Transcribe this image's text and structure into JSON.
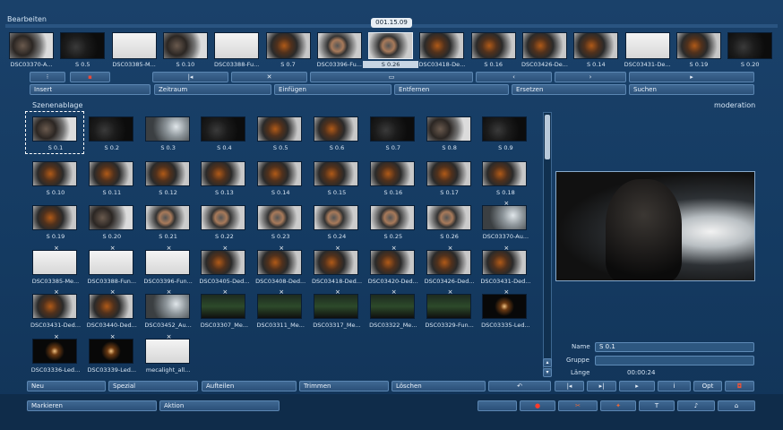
{
  "header": {
    "section_edit": "Bearbeiten",
    "timecode": "001.15.09"
  },
  "timeline": {
    "captions": [
      "DSC03370-A...",
      "S 0.5",
      "DSC03385-M...",
      "S 0.10",
      "DSC03388-Fu...",
      "S 0.7",
      "DSC03396-Fu...",
      "S 0.26",
      "DSC03418-De...",
      "S 0.16",
      "DSC03426-De...",
      "S 0.14",
      "DSC03431-De...",
      "S 0.19",
      "S 0.20"
    ]
  },
  "toolbar1": {
    "insert": "Insert",
    "timespan": "Zeitraum",
    "paste": "Einfügen",
    "remove": "Entfernen",
    "replace": "Ersetzen",
    "search": "Suchen"
  },
  "bin": {
    "title": "Szenenablage",
    "category": "moderation"
  },
  "scenes": [
    [
      "S 0.1",
      "S 0.2",
      "S 0.3",
      "S 0.4",
      "S 0.5",
      "S 0.6",
      "S 0.7",
      "S 0.8",
      "S 0.9"
    ],
    [
      "S 0.10",
      "S 0.11",
      "S 0.12",
      "S 0.13",
      "S 0.14",
      "S 0.15",
      "S 0.16",
      "S 0.17",
      "S 0.18"
    ],
    [
      "S 0.19",
      "S 0.20",
      "S 0.21",
      "S 0.22",
      "S 0.23",
      "S 0.24",
      "S 0.25",
      "S 0.26",
      "DSC03370-Au..."
    ],
    [
      "DSC03385-Me...",
      "DSC03388-Fun...",
      "DSC03396-Fun...",
      "DSC03405-Ded...",
      "DSC03408-Ded...",
      "DSC03418-Ded...",
      "DSC03420-Ded...",
      "DSC03426-Ded...",
      "DSC03431-Ded..."
    ],
    [
      "DSC03431-Ded...",
      "DSC03440-Ded...",
      "DSC03452_Au...",
      "DSC03307_Me...",
      "DSC03311_Me...",
      "DSC03317_Me...",
      "DSC03322_Me...",
      "DSC03329-Fun...",
      "DSC03335-Led..."
    ],
    [
      "DSC03336-Led...",
      "DSC03339-Led...",
      "mecalight_all..."
    ]
  ],
  "details": {
    "name_label": "Name",
    "name_value": "S 0.1",
    "group_label": "Gruppe",
    "group_value": "",
    "length_label": "Länge",
    "length_value": "00:00:24"
  },
  "toolbar2": {
    "new": "Neu",
    "special": "Spezial",
    "split": "Aufteilen",
    "trim": "Trimmen",
    "delete": "Löschen",
    "opt": "Opt"
  },
  "footer": {
    "mark": "Markieren",
    "action": "Aktion"
  }
}
